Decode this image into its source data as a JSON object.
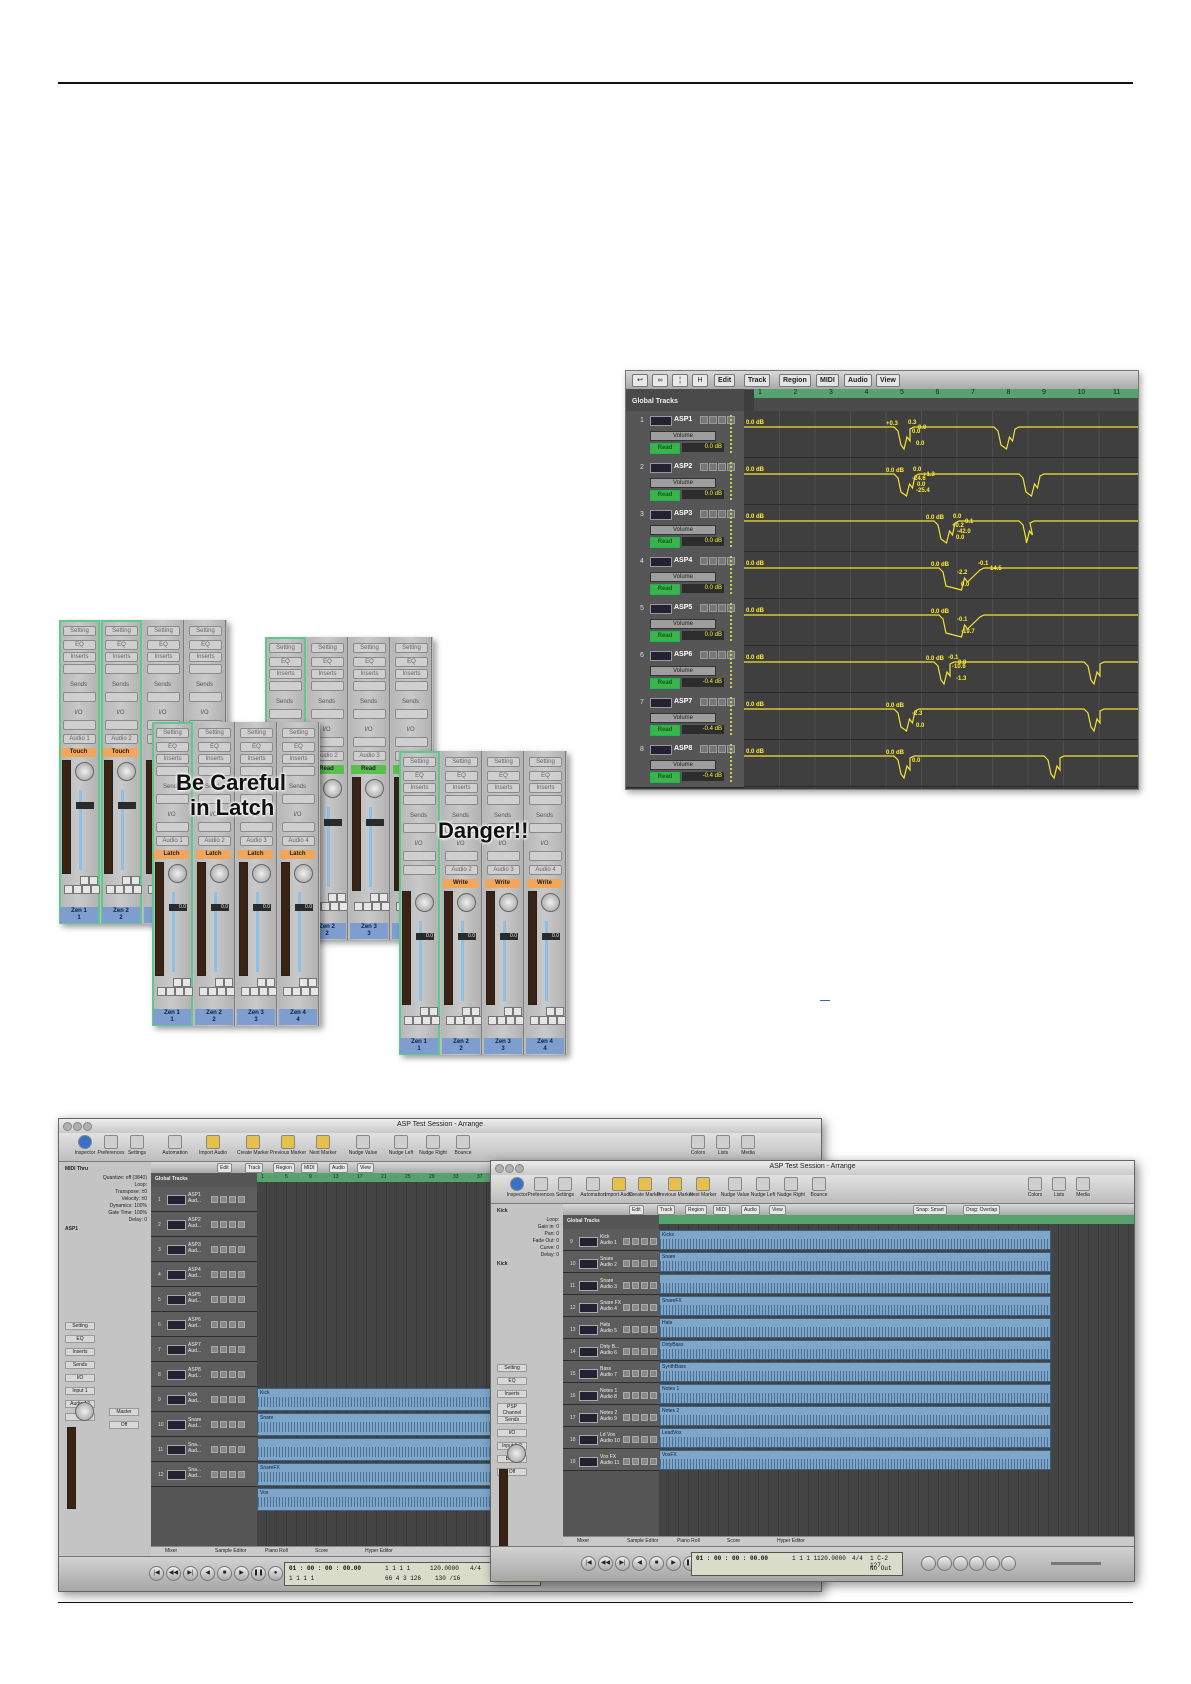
{
  "automation_window": {
    "toolbar_menus": [
      "Edit",
      "Track",
      "Region",
      "MIDI",
      "Audio",
      "View"
    ],
    "global_tracks_label": "Global Tracks",
    "ruler_numbers": [
      "1",
      "2",
      "3",
      "4",
      "5",
      "6",
      "7",
      "8",
      "9",
      "10",
      "11"
    ],
    "volume_label": "Volume",
    "read_label": "Read",
    "tracks": [
      {
        "num": "1",
        "name": "ASP1",
        "db": "0.0 dB",
        "labels": [
          "0.0 dB",
          "+0.3",
          "0.0",
          "0.0",
          "0.3",
          "0.0"
        ]
      },
      {
        "num": "2",
        "name": "ASP2",
        "db": "0.0 dB",
        "labels": [
          "0.0 dB",
          "0.0 dB",
          "-24.6",
          "-25.4",
          "0.0",
          "+1.3",
          "0.0"
        ]
      },
      {
        "num": "3",
        "name": "ASP3",
        "db": "0.0 dB",
        "labels": [
          "0.0 dB",
          "0.0 dB",
          "+0.2",
          "0.0",
          "0.0",
          "-0.1",
          "-42.0"
        ]
      },
      {
        "num": "4",
        "name": "ASP4",
        "db": "0.0 dB",
        "labels": [
          "0.0 dB",
          "0.0 dB",
          "-2.2",
          "0.0",
          "-0.1",
          "-14.5"
        ]
      },
      {
        "num": "5",
        "name": "ASP5",
        "db": "0.0 dB",
        "labels": [
          "0.0 dB",
          "0.0 dB",
          "-0.1",
          "-19.7"
        ]
      },
      {
        "num": "6",
        "name": "ASP6",
        "db": "-0.4 dB",
        "labels": [
          "0.0 dB",
          "0.0 dB",
          "-10.6",
          "-1.3",
          "-0.1",
          "0.0"
        ]
      },
      {
        "num": "7",
        "name": "ASP7",
        "db": "-0.4 dB",
        "labels": [
          "0.0 dB",
          "0.0 dB",
          "-2.3",
          "0.0"
        ]
      },
      {
        "num": "8",
        "name": "ASP8",
        "db": "-0.4 dB",
        "labels": [
          "0.0 dB",
          "0.0 dB",
          "0.0"
        ]
      }
    ]
  },
  "mixers": {
    "strip_labels": {
      "setting": "Setting",
      "eq": "EQ",
      "inserts": "Inserts",
      "sends": "Sends",
      "io": "I/O"
    },
    "touch_group": {
      "modes": [
        "Touch",
        "Touch",
        "",
        ""
      ],
      "audio": [
        "Audio 1",
        "Audio 2",
        "",
        ""
      ],
      "names": [
        "Zen 1",
        "Zen 2",
        "",
        ""
      ],
      "nums": [
        "1",
        "2",
        "",
        ""
      ]
    },
    "read_group": {
      "modes": [
        "",
        "Read",
        "Read",
        "Read"
      ],
      "audio": [
        "",
        "Audio 2",
        "Audio 3",
        "Audio 4"
      ],
      "names": [
        "",
        "Zen 2",
        "Zen 3",
        "Zen 4"
      ],
      "nums": [
        "",
        "2",
        "3",
        "4"
      ]
    },
    "latch_group": {
      "modes": [
        "Latch",
        "Latch",
        "Latch",
        "Latch"
      ],
      "audio": [
        "Audio 1",
        "Audio 2",
        "Audio 3",
        "Audio 4"
      ],
      "names": [
        "Zen 1",
        "Zen 2",
        "Zen 3",
        "Zen 4"
      ],
      "nums": [
        "1",
        "2",
        "3",
        "4"
      ],
      "db": [
        "0.0",
        "0.0",
        "0.0",
        "0.0"
      ]
    },
    "write_group": {
      "modes": [
        "",
        "Write",
        "Write",
        "Write"
      ],
      "audio": [
        "",
        "Audio 2",
        "Audio 3",
        "Audio 4"
      ],
      "names": [
        "Zen 1",
        "Zen 2",
        "Zen 3",
        "Zen 4"
      ],
      "nums": [
        "1",
        "2",
        "3",
        "4"
      ],
      "db": [
        "0.0",
        "0.0",
        "0.0",
        "0.0"
      ]
    },
    "caption_latch_1": "Be Careful",
    "caption_latch_2": "in Latch",
    "caption_write": "Danger!!"
  },
  "arrange_left": {
    "title": "ASP Test Session - Arrange",
    "toolbar": [
      "Inspector",
      "Preferences",
      "Settings",
      "Automation",
      "Import Audio",
      "Create Marker",
      "Previous Marker",
      "Next Marker",
      "Nudge Value",
      "Nudge Left",
      "Nudge Right",
      "Bounce",
      "Colors",
      "Lists",
      "Media"
    ],
    "menus": [
      "Edit",
      "Track",
      "Region",
      "MIDI",
      "Audio",
      "View"
    ],
    "inspector": {
      "header": "MIDI Thru",
      "rows": [
        "Quantize: off (3840)",
        "Loop:",
        "Transpose: ±0",
        "Velocity: ±0",
        "Dynamics: 100%",
        "Gate Time: 100%",
        "Delay: 0"
      ],
      "section2": "ASP1",
      "strip1": [
        "Setting",
        "EQ",
        "Inserts",
        "Sends",
        "I/O",
        "Input 1",
        "Audio 12",
        "Off"
      ],
      "strip2": [
        "Master",
        "Off"
      ]
    },
    "global_tracks_label": "Global Tracks",
    "ruler": [
      "1",
      "5",
      "9",
      "13",
      "17",
      "21",
      "25",
      "29",
      "33",
      "37"
    ],
    "tracks": [
      {
        "n": "1",
        "l1": "ASP1",
        "l2": "Aud..."
      },
      {
        "n": "2",
        "l1": "ASP2",
        "l2": "Aud..."
      },
      {
        "n": "3",
        "l1": "ASP3",
        "l2": "Aud..."
      },
      {
        "n": "4",
        "l1": "ASP4",
        "l2": "Aud..."
      },
      {
        "n": "5",
        "l1": "ASP5",
        "l2": "Aud..."
      },
      {
        "n": "6",
        "l1": "ASP6",
        "l2": "Aud..."
      },
      {
        "n": "7",
        "l1": "ASP7",
        "l2": "Aud..."
      },
      {
        "n": "8",
        "l1": "ASP8",
        "l2": "Aud..."
      },
      {
        "n": "9",
        "l1": "Kick",
        "l2": "Aud..."
      },
      {
        "n": "10",
        "l1": "Snare",
        "l2": "Aud..."
      },
      {
        "n": "11",
        "l1": "Sna...",
        "l2": "Aud..."
      },
      {
        "n": "12",
        "l1": "Sna...",
        "l2": "Aud..."
      }
    ],
    "regions": [
      "Kick",
      "Snare",
      "",
      "SnareFX",
      "Vox"
    ],
    "tabs": [
      "Mixer",
      "Sample Editor",
      "Piano Roll",
      "Score",
      "Hyper Editor"
    ],
    "lcd": {
      "time": "01 : 00 : 00 : 00.00",
      "bars": "1   1   1   1",
      "bars2": "1   1   1   1",
      "tempo": "120.0000",
      "tempo2": "66  4  3  126",
      "sig": "4/4",
      "sig2": "130    /16",
      "key": "1 C-2   127",
      "out": "No Out"
    }
  },
  "arrange_right": {
    "title": "ASP Test Session - Arrange",
    "toolbar": [
      "Inspector",
      "Preferences",
      "Settings",
      "Automation",
      "Import Audio",
      "Create Marker",
      "Previous Marker",
      "Next Marker",
      "Nudge Value",
      "Nudge Left",
      "Nudge Right",
      "Bounce",
      "Colors",
      "Lists",
      "Media"
    ],
    "inspector": {
      "header": "Kick",
      "rows": [
        "Loop:",
        "Gain in: 0",
        "Pan: 0",
        "Fade Out: 0",
        "Curve: 0",
        "Delay: 0"
      ],
      "section2": "Kick",
      "strips": [
        "Setting",
        "EQ",
        "Inserts",
        "PSP Channel",
        "Sends",
        "I/O",
        "Input 1-2",
        "Bus 2",
        "Off"
      ]
    },
    "snap": "Snap: Smart",
    "drag": "Drag: Overlap",
    "global_tracks_label": "Global Tracks",
    "tracks": [
      {
        "n": "9",
        "l1": "Kick",
        "l2": "Audio 1"
      },
      {
        "n": "10",
        "l1": "Snare",
        "l2": "Audio 2"
      },
      {
        "n": "11",
        "l1": "Snare",
        "l2": "Audio 3"
      },
      {
        "n": "12",
        "l1": "Snare FX",
        "l2": "Audio 4"
      },
      {
        "n": "13",
        "l1": "Hats",
        "l2": "Audio 5"
      },
      {
        "n": "14",
        "l1": "Dirty B...",
        "l2": "Audio 6"
      },
      {
        "n": "15",
        "l1": "Bass",
        "l2": "Audio 7"
      },
      {
        "n": "16",
        "l1": "Notes 1",
        "l2": "Audio 8"
      },
      {
        "n": "17",
        "l1": "Notes 2",
        "l2": "Audio 9"
      },
      {
        "n": "18",
        "l1": "Ld Vox",
        "l2": "Audio 10"
      },
      {
        "n": "19",
        "l1": "Vox FX",
        "l2": "Audio 11"
      }
    ],
    "regions": [
      "Kicks",
      "Snare",
      "",
      "SnareFX",
      "Hats",
      "DirtyBass",
      "SynthBass",
      "Notes 1",
      "Notes 2",
      "LeadVox",
      "VoxFX"
    ],
    "tabs": [
      "Mixer",
      "Sample Editor",
      "Piano Roll",
      "Score",
      "Hyper Editor"
    ],
    "lcd": {
      "time": "01 : 00 : 00 : 00.00",
      "bars": "1   1   1   1",
      "tempo": "120.0000",
      "sig": "4/4",
      "key": "1 C-2   127",
      "out": "No Out"
    }
  }
}
